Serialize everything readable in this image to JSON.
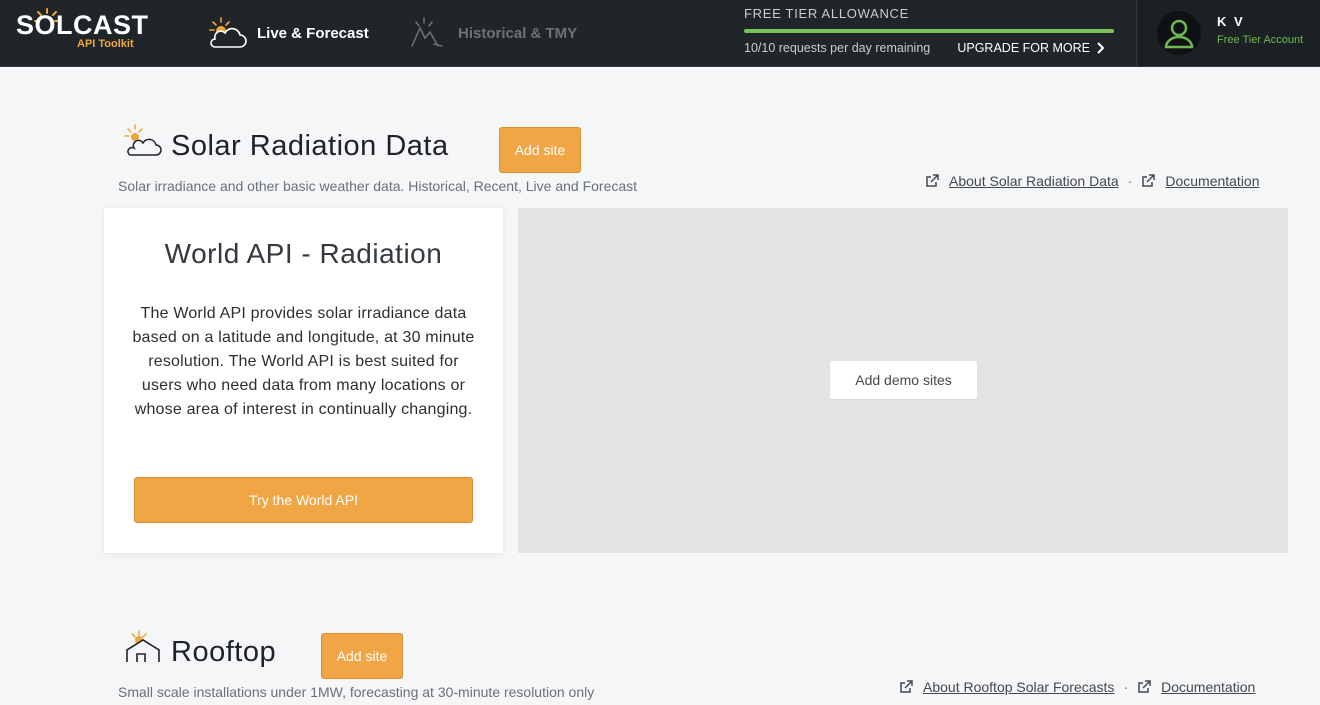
{
  "header": {
    "logo_text": "SOLCAST",
    "logo_sub": "API Toolkit",
    "tabs": [
      {
        "label": "Live & Forecast",
        "active": true
      },
      {
        "label": "Historical & TMY",
        "active": false
      }
    ],
    "allowance": {
      "title": "FREE TIER ALLOWANCE",
      "remaining": "10/10 requests per day remaining",
      "upgrade_label": "UPGRADE FOR MORE",
      "fraction_remaining": 1.0
    },
    "account": {
      "name": "K V",
      "tier": "Free Tier Account"
    }
  },
  "sections": [
    {
      "title": "Solar Radiation Data",
      "add_site_label": "Add site",
      "description": "Solar irradiance and other basic weather data. Historical, Recent, Live and Forecast",
      "about_link": "About Solar Radiation Data",
      "doc_link": "Documentation",
      "separator": "·",
      "card": {
        "title": "World API - Radiation",
        "text": "The World API provides solar irradiance data based on a latitude and longitude, at 30 minute resolution. The World API is best suited for users who need data from many locations or whose area of interest in continually changing.",
        "button": "Try the World API"
      },
      "map": {
        "demo_button": "Add demo sites"
      }
    },
    {
      "title": "Rooftop",
      "add_site_label": "Add site",
      "description": "Small scale installations under 1MW, forecasting at 30-minute resolution only",
      "about_link": "About Rooftop Solar Forecasts",
      "doc_link": "Documentation",
      "separator": "·"
    }
  ],
  "colors": {
    "header_bg": "#1f2529",
    "accent_orange": "#f0a645",
    "allowance_green": "#7bc25c",
    "page_bg": "#f5f6f7"
  },
  "icons": [
    "sun-cloud-icon",
    "historical-icon",
    "chevron-right-icon",
    "avatar-icon",
    "external-link-icon",
    "sun-house-icon"
  ]
}
